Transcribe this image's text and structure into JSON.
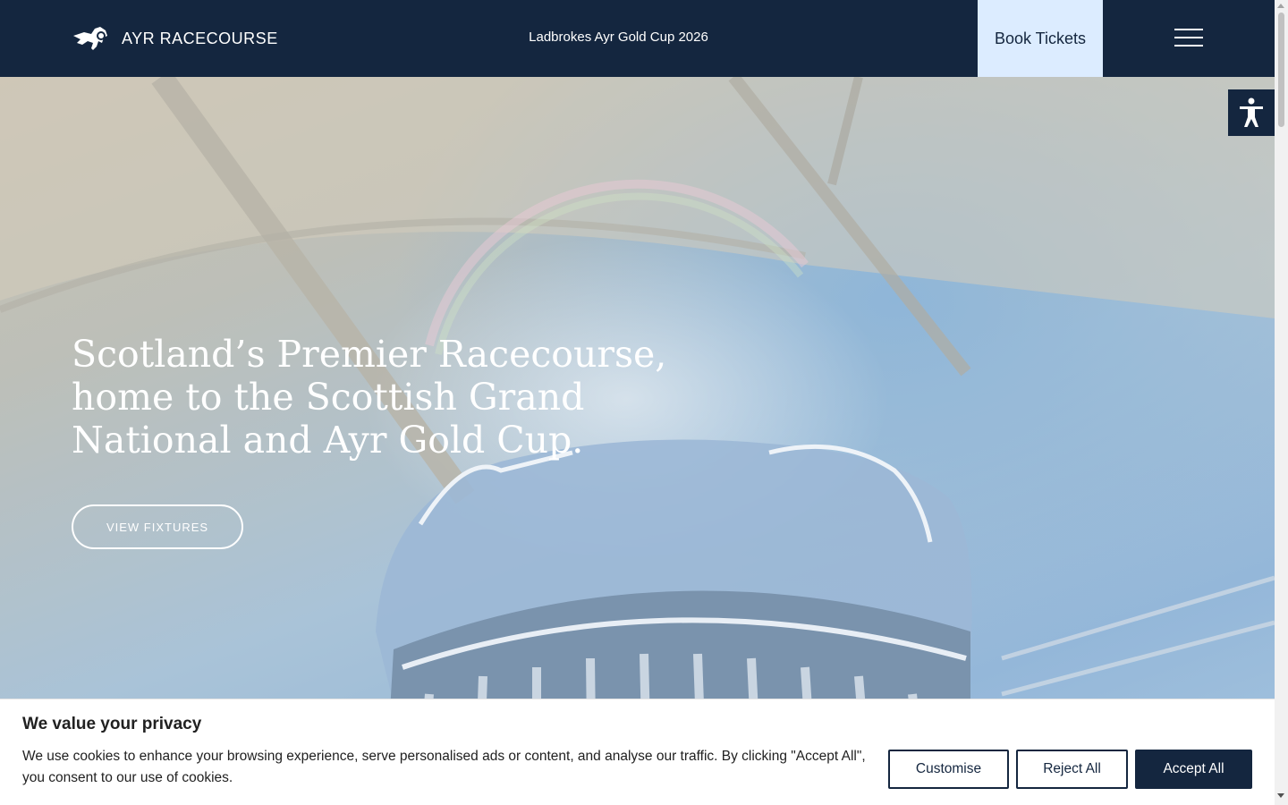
{
  "header": {
    "logo_text": "AYR RACECOURSE",
    "event_link": "Ladbrokes Ayr Gold Cup 2026",
    "book_tickets": "Book Tickets",
    "menu_icon": "hamburger-menu-icon"
  },
  "hero": {
    "title": "Scotland’s Premier Racecourse, home to the Scottish Grand National and Ayr Gold Cup.",
    "cta": "VIEW FIXTURES"
  },
  "accessibility": {
    "icon": "accessibility-icon"
  },
  "cookie_banner": {
    "title": "We value your privacy",
    "text": "We use cookies to enhance your browsing experience, serve personalised ads or content, and analyse our traffic. By clicking \"Accept All\", you consent to our use of cookies.",
    "customise": "Customise",
    "reject_all": "Reject All",
    "accept_all": "Accept All"
  },
  "colors": {
    "navy": "#14263f",
    "book_button_bg": "#dcecff",
    "white": "#ffffff"
  }
}
